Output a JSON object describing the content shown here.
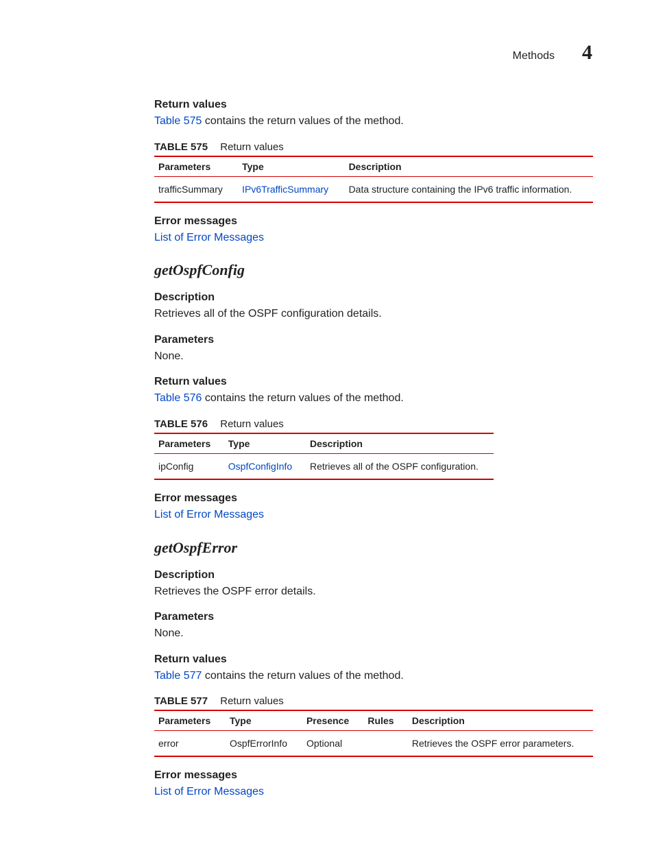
{
  "header": {
    "section": "Methods",
    "chapter": "4"
  },
  "section1": {
    "returnValuesHead": "Return values",
    "returnValuesLink": "Table 575",
    "returnValuesTail": " contains the return values of the method.",
    "tableLabel": "TABLE 575",
    "tableTitle": "Return values",
    "headers": {
      "c0": "Parameters",
      "c1": "Type",
      "c2": "Description"
    },
    "row": {
      "param": "trafficSummary",
      "type": "IPv6TrafficSummary",
      "desc": "Data structure containing the IPv6 traffic information."
    },
    "errorHead": "Error messages",
    "errorLink": "List of Error Messages"
  },
  "method1": {
    "title": "getOspfConfig",
    "descHead": "Description",
    "descText": "Retrieves all of the OSPF configuration details.",
    "paramHead": "Parameters",
    "paramText": "None.",
    "returnValuesHead": "Return values",
    "returnValuesLink": "Table 576",
    "returnValuesTail": " contains the return values of the method.",
    "tableLabel": "TABLE 576",
    "tableTitle": "Return values",
    "headers": {
      "c0": "Parameters",
      "c1": "Type",
      "c2": "Description"
    },
    "row": {
      "param": "ipConfig",
      "type": "OspfConfigInfo",
      "desc": "Retrieves all of the OSPF configuration."
    },
    "errorHead": "Error messages",
    "errorLink": "List of Error Messages"
  },
  "method2": {
    "title": "getOspfError",
    "descHead": "Description",
    "descText": "Retrieves the OSPF error details.",
    "paramHead": "Parameters",
    "paramText": "None.",
    "returnValuesHead": "Return values",
    "returnValuesLink": "Table 577",
    "returnValuesTail": " contains the return values of the method.",
    "tableLabel": "TABLE 577",
    "tableTitle": "Return values",
    "headers": {
      "c0": "Parameters",
      "c1": "Type",
      "c2": "Presence",
      "c3": "Rules",
      "c4": "Description"
    },
    "row": {
      "param": "error",
      "type": "OspfErrorInfo",
      "presence": "Optional",
      "rules": "",
      "desc": "Retrieves the OSPF error parameters."
    },
    "errorHead": "Error messages",
    "errorLink": "List of Error Messages"
  }
}
